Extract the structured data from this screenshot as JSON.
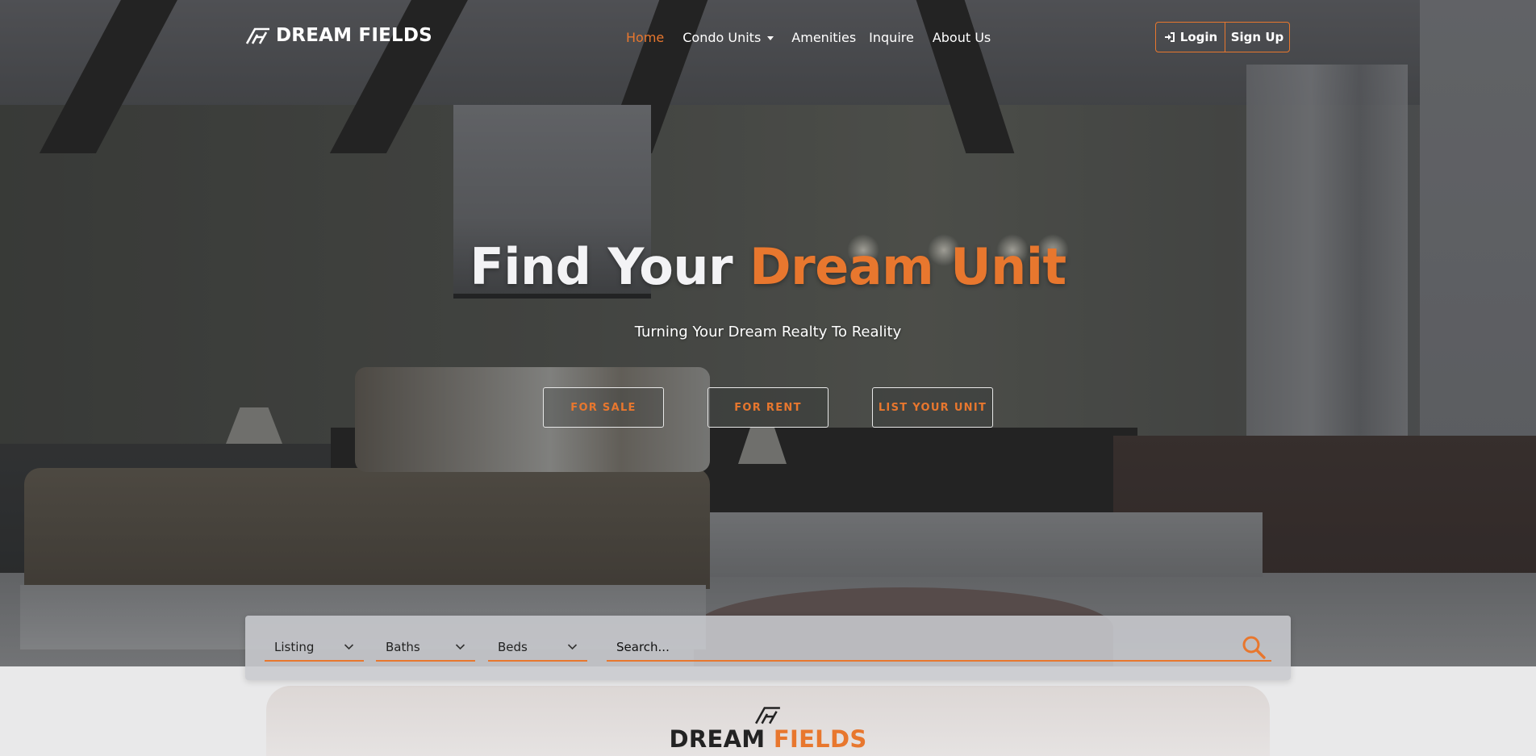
{
  "brand": {
    "name": "DREAM FIELDS",
    "logo_icon": "df-monogram-icon"
  },
  "nav": {
    "items": [
      {
        "label": "Home",
        "active": true
      },
      {
        "label": "Condo Units",
        "dropdown": true
      },
      {
        "label": "Amenities"
      },
      {
        "label": "Inquire"
      },
      {
        "label": "About Us"
      }
    ]
  },
  "auth": {
    "login_label": "Login",
    "login_icon": "sign-in-icon",
    "signup_label": "Sign Up"
  },
  "hero": {
    "title_plain": "Find Your ",
    "title_accent": "Dream Unit",
    "subtitle": "Turning Your Dream Realty To Reality",
    "buttons": [
      "FOR SALE",
      "FOR RENT",
      "LIST YOUR UNIT"
    ]
  },
  "search": {
    "selects": [
      {
        "label": "Listing"
      },
      {
        "label": "Baths"
      },
      {
        "label": "Beds"
      }
    ],
    "placeholder": "Search...",
    "button_icon": "search-icon"
  },
  "footer_logo": {
    "word1": "DREAM",
    "word2": "FIELDS"
  },
  "colors": {
    "accent": "#e8772e",
    "text_light": "#ffffff",
    "text_dark": "#232323"
  }
}
